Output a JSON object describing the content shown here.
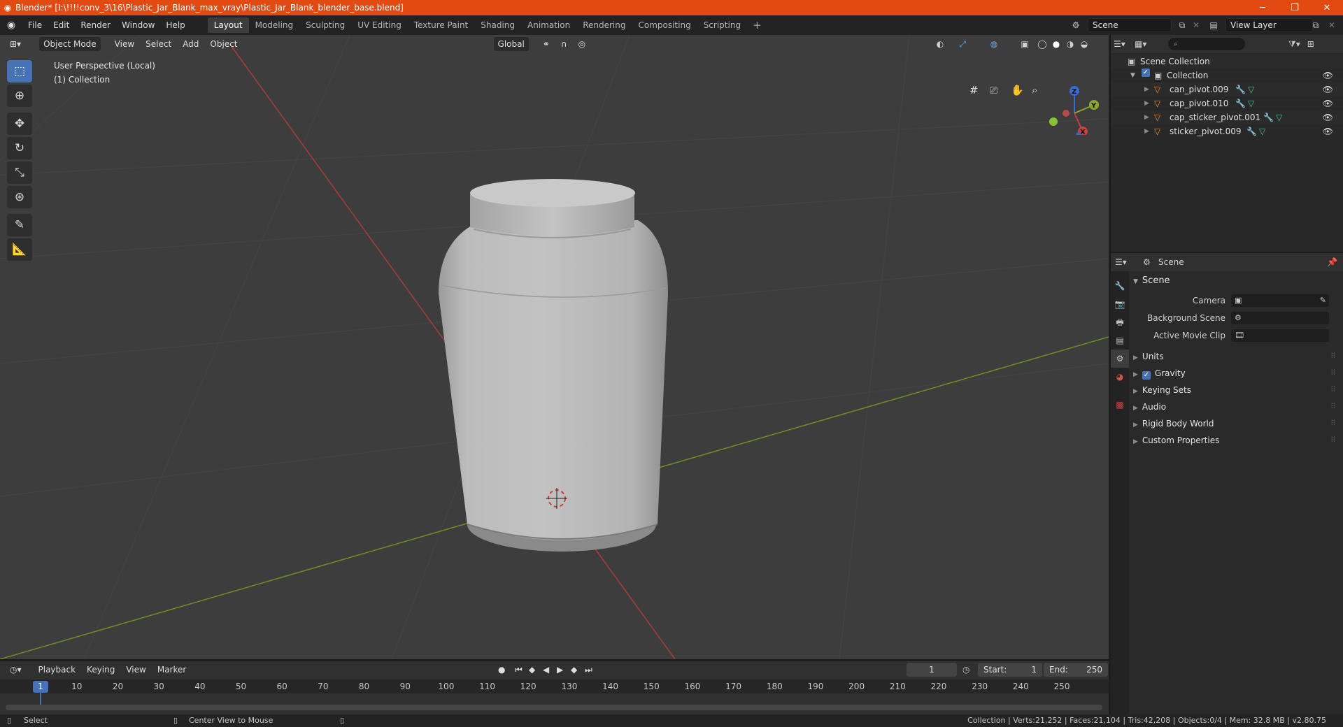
{
  "window": {
    "title": "Blender* [I:\\!!!!conv_3\\16\\Plastic_Jar_Blank_max_vray\\Plastic_Jar_Blank_blender_base.blend]",
    "minimize": "─",
    "maximize": "❐",
    "close": "✕"
  },
  "menu": [
    "File",
    "Edit",
    "Render",
    "Window",
    "Help"
  ],
  "workspaces": [
    "Layout",
    "Modeling",
    "Sculpting",
    "UV Editing",
    "Texture Paint",
    "Shading",
    "Animation",
    "Rendering",
    "Compositing",
    "Scripting"
  ],
  "workspace_add": "+",
  "scene_field": "Scene",
  "view_layer_field": "View Layer",
  "viewport": {
    "mode": "Object Mode",
    "menus": [
      "View",
      "Select",
      "Add",
      "Object"
    ],
    "transform_orientation": "Global",
    "info_line1": "User Perspective (Local)",
    "info_line2": "(1) Collection",
    "gizmo_axes": {
      "z": "Z",
      "y": "Y",
      "x": "X"
    },
    "colors": {
      "background": "#3d3d3d",
      "x_axis": "#b04040",
      "y_axis": "#7a9a2a",
      "active": "#4772b3"
    }
  },
  "outliner": {
    "search_placeholder": "⌕",
    "root": "Scene Collection",
    "collection": "Collection",
    "objects": [
      {
        "name": "can_pivot.009"
      },
      {
        "name": "cap_pivot.010"
      },
      {
        "name": "cap_sticker_pivot.001"
      },
      {
        "name": "sticker_pivot.009"
      }
    ]
  },
  "properties": {
    "header_title": "Scene",
    "section_scene": "Scene",
    "camera_label": "Camera",
    "background_scene_label": "Background Scene",
    "active_movie_clip_label": "Active Movie Clip",
    "sections": [
      "Units",
      "Gravity",
      "Keying Sets",
      "Audio",
      "Rigid Body World",
      "Custom Properties"
    ],
    "gravity_checked": true
  },
  "timeline": {
    "menus": [
      "Playback",
      "Keying",
      "View",
      "Marker"
    ],
    "current_frame": "1",
    "start_label": "Start:",
    "start_value": "1",
    "end_label": "End:",
    "end_value": "250",
    "ruler_current": "1",
    "ticks": [
      "10",
      "20",
      "30",
      "40",
      "50",
      "60",
      "70",
      "80",
      "90",
      "100",
      "110",
      "120",
      "130",
      "140",
      "150",
      "160",
      "170",
      "180",
      "190",
      "200",
      "210",
      "220",
      "230",
      "240",
      "250"
    ]
  },
  "status": {
    "left_action": "Select",
    "middle_action": "Center View to Mouse",
    "stats": "Collection | Verts:21,252 | Faces:21,104 | Tris:42,208 | Objects:0/4 | Mem: 32.8 MB | v2.80.75"
  }
}
